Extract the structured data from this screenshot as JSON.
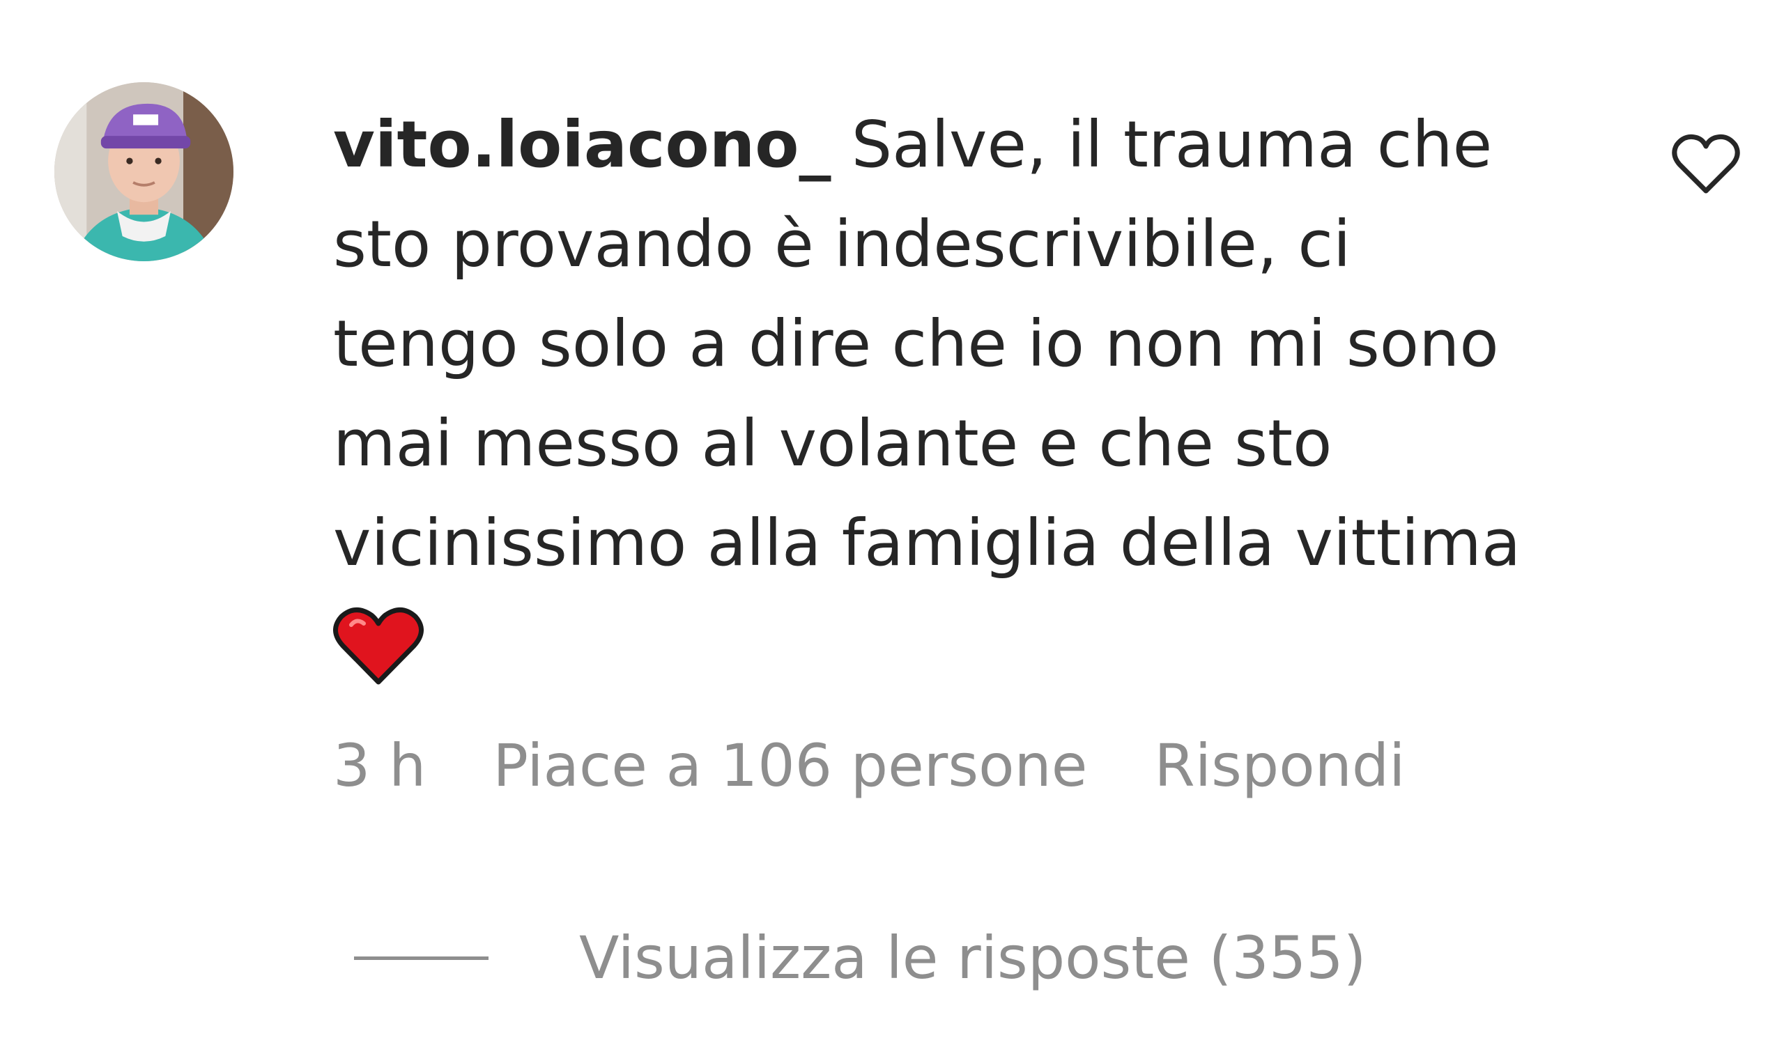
{
  "comment": {
    "username": "vito.loiacono_",
    "text_lines": [
      "Salve, il trauma che",
      "sto provando è indescrivibile, ci",
      "tengo solo a dire che io non mi sono",
      "mai messo al volante e che sto",
      "vicinissimo alla famiglia della vittima"
    ],
    "emoji": "red-heart",
    "time": "3 h",
    "likes": "Piace a 106 persone",
    "reply_label": "Rispondi",
    "view_replies": "Visualizza le risposte (355)"
  },
  "icons": {
    "like": "heart-outline-icon",
    "emoji": "red-heart-emoji"
  },
  "colors": {
    "text": "#262626",
    "secondary": "#8e8e8e",
    "heart_red": "#e0141e"
  }
}
